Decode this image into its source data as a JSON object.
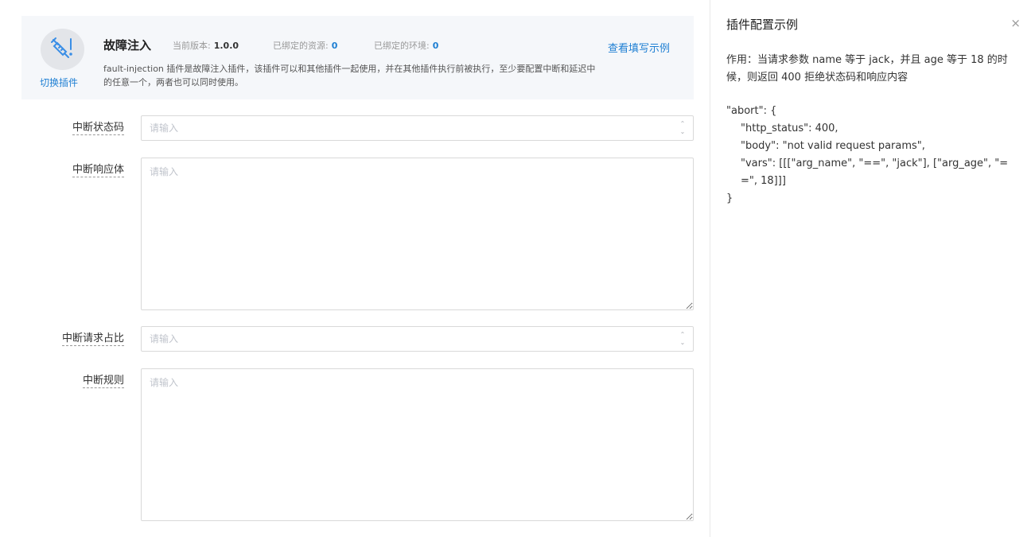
{
  "plugin": {
    "switch_label": "切换插件",
    "name": "故障注入",
    "version_label": "当前版本:",
    "version_value": "1.0.0",
    "resources_label": "已绑定的资源:",
    "resources_value": "0",
    "env_label": "已绑定的环境:",
    "env_value": "0",
    "example_link": "查看填写示例",
    "description": "fault-injection 插件是故障注入插件，该插件可以和其他插件一起使用，并在其他插件执行前被执行，至少要配置中断和延迟中的任意一个，两者也可以同时使用。"
  },
  "form": {
    "fields": [
      {
        "label": "中断状态码",
        "placeholder": "请输入",
        "kind": "number"
      },
      {
        "label": "中断响应体",
        "placeholder": "请输入",
        "kind": "textarea"
      },
      {
        "label": "中断请求占比",
        "placeholder": "请输入",
        "kind": "number"
      },
      {
        "label": "中断规则",
        "placeholder": "请输入",
        "kind": "textarea"
      }
    ]
  },
  "panel": {
    "title": "插件配置示例",
    "close_glyph": "×",
    "description": "作用：当请求参数 name 等于 jack，并且 age 等于 18 的时候，则返回 400 拒绝状态码和响应内容",
    "code": [
      "\"abort\": {",
      "\"http_status\": 400,",
      "\"body\": \"not valid request params\",",
      "\"vars\": [[[\"arg_name\", \"==\", \"jack\"], [\"arg_age\", \"==\", 18]]]",
      "}"
    ]
  },
  "icons": {
    "plugin_logo": "syringe-exclamation-icon",
    "close": "close-icon",
    "spinner": "number-stepper-icon"
  },
  "colors": {
    "accent": "#1e7fd3",
    "card_bg": "#f5f7fa",
    "border": "#d9d9d9"
  }
}
